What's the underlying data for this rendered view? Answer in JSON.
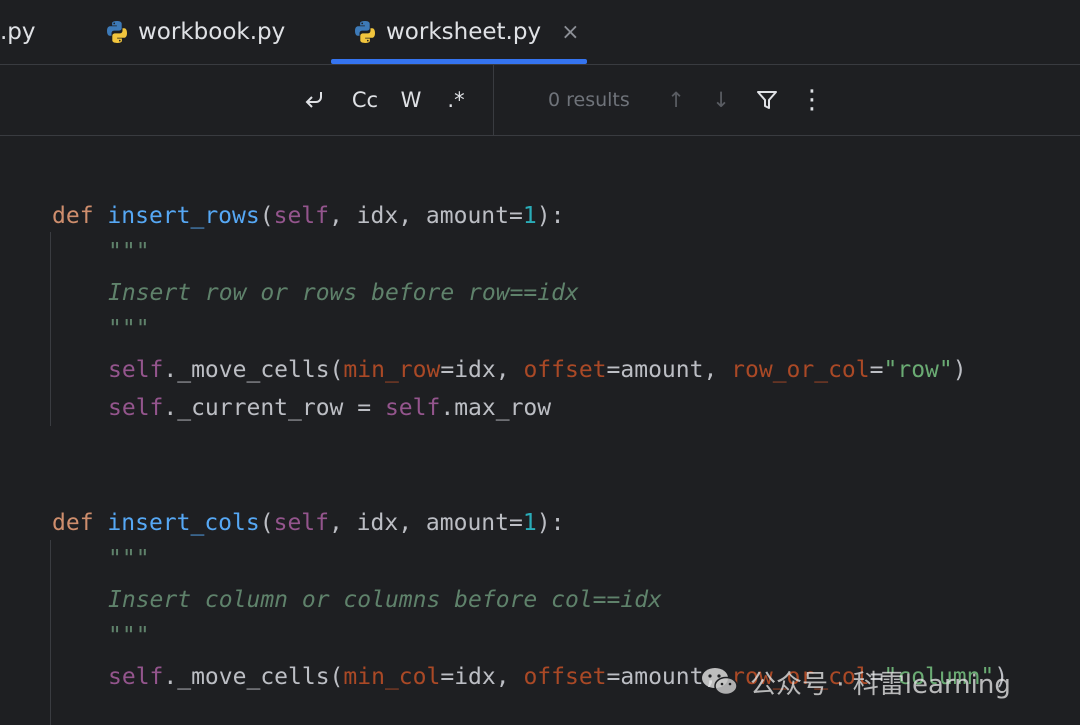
{
  "tabs": [
    {
      "label": ".py",
      "active": false
    },
    {
      "label": "workbook.py",
      "active": false
    },
    {
      "label": "worksheet.py",
      "active": true
    }
  ],
  "tab_close_glyph": "×",
  "search": {
    "buttons": [
      {
        "name": "new-line-icon",
        "label": "↩"
      },
      {
        "name": "match-case-button",
        "label": "Cc"
      },
      {
        "name": "whole-words-button",
        "label": "W"
      },
      {
        "name": "regex-button",
        "label": ".*"
      }
    ],
    "results": "0 results",
    "up_glyph": "↑",
    "down_glyph": "↓",
    "more_glyph": "⋮"
  },
  "code": {
    "f1": {
      "def": "def",
      "name": "insert_rows",
      "p_open": "(",
      "self": "self",
      "args": ", idx, amount=",
      "num": "1",
      "p_close": "):",
      "doc_open": "\"\"\"",
      "doc_text": "Insert row or rows before row==idx",
      "doc_close": "\"\"\"",
      "l1_self": "self",
      "l1_call": "._move_cells(",
      "l1_k1": "min_row",
      "l1_v1": "=idx, ",
      "l1_k2": "offset",
      "l1_v2": "=amount, ",
      "l1_k3": "row_or_col",
      "l1_eq": "=",
      "l1_str": "\"row\"",
      "l1_end": ")",
      "l2_self": "self",
      "l2_attr": "._current_row = ",
      "l2_self2": "self",
      "l2_end": ".max_row"
    },
    "f2": {
      "def": "def",
      "name": "insert_cols",
      "p_open": "(",
      "self": "self",
      "args": ", idx, amount=",
      "num": "1",
      "p_close": "):",
      "doc_open": "\"\"\"",
      "doc_text": "Insert column or columns before col==idx",
      "doc_close": "\"\"\"",
      "l1_self": "self",
      "l1_call": "._move_cells(",
      "l1_k1": "min_col",
      "l1_v1": "=idx, ",
      "l1_k2": "offset",
      "l1_v2": "=amount, ",
      "l1_k3": "row_or_col",
      "l1_eq": "=",
      "l1_str": "\"column\"",
      "l1_end": ")"
    }
  },
  "watermark": "公众号 · 科雷learning",
  "colors": {
    "keyword": "#cf8e6d",
    "function": "#56a8f5",
    "self": "#94558d",
    "number": "#2aacb8",
    "docstring": "#5f826b",
    "param": "#aa4926",
    "string": "#6aab73",
    "accent": "#3574f0"
  }
}
